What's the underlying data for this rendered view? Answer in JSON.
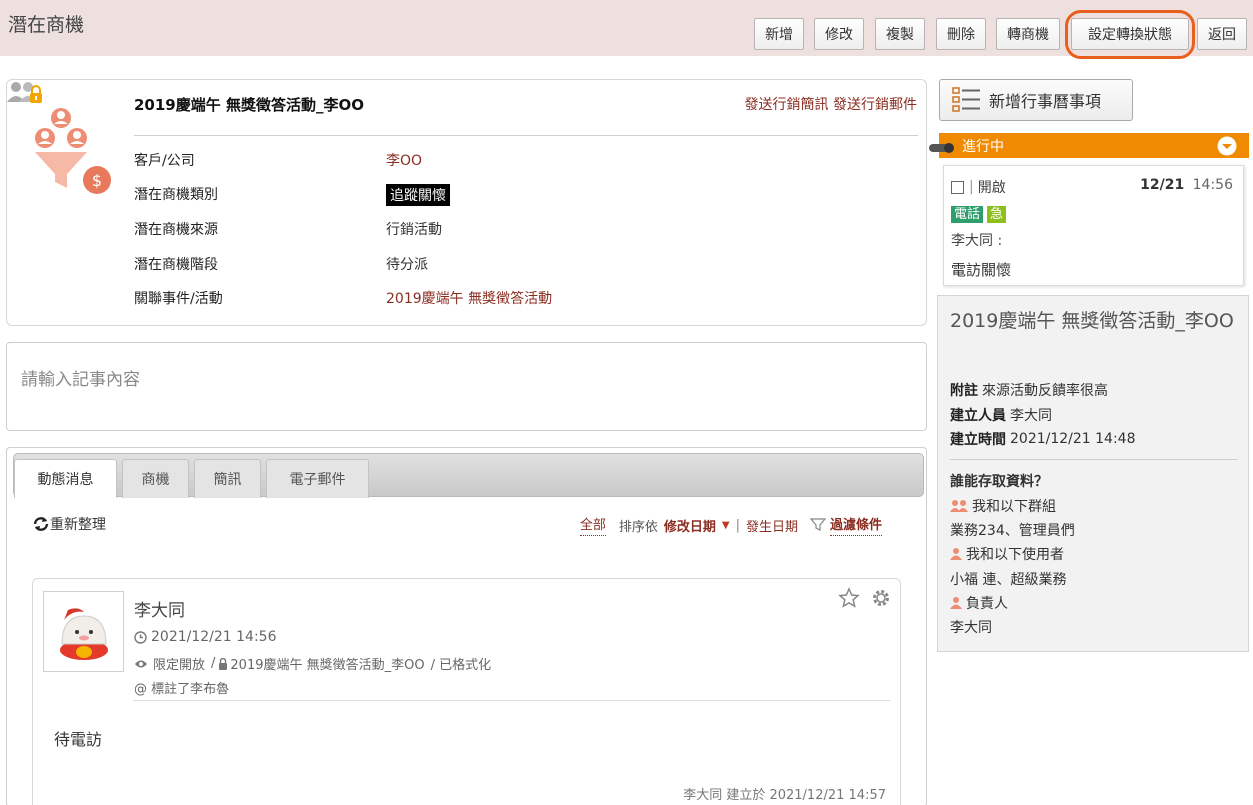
{
  "header": {
    "title": "潛在商機",
    "buttons": {
      "add": "新增",
      "edit": "修改",
      "copy": "複製",
      "delete": "刪除",
      "convert": "轉商機",
      "set_status": "設定轉換狀態",
      "back": "返回"
    }
  },
  "record": {
    "title": "2019慶端午 無獎徵答活動_李OO",
    "links": {
      "send_sms": "發送行銷簡訊",
      "send_mail": "發送行銷郵件"
    },
    "fields": [
      {
        "label": "客戶/公司",
        "value": "李OO"
      },
      {
        "label": "潛在商機類別",
        "value": "追蹤關懷"
      },
      {
        "label": "潛在商機來源",
        "value": "行銷活動"
      },
      {
        "label": "潛在商機階段",
        "value": "待分派"
      },
      {
        "label": "關聯事件/活動",
        "value": "2019慶端午 無獎徵答活動"
      }
    ]
  },
  "notes": {
    "placeholder": "請輸入記事內容"
  },
  "feed": {
    "tabs": [
      "動態消息",
      "商機",
      "簡訊",
      "電子郵件"
    ],
    "refresh": "重新整理",
    "sort": {
      "all": "全部",
      "sort_by": "排序依",
      "modified": "修改日期",
      "sep": "|",
      "occurred": "發生日期",
      "filter": "過濾條件"
    },
    "post": {
      "author": "李大同",
      "time": "2021/12/21 14:56",
      "visibility": "限定開放",
      "link": "2019慶端午 無獎徵答活動_李OO",
      "formatted": "/ 已格式化",
      "mention": "@ 標註了李布魯",
      "body": "待電訪",
      "footer": "李大同 建立於 2021/12/21 14:57"
    }
  },
  "calendar": {
    "add_label": "新增行事曆事項"
  },
  "progress": {
    "label": "進行中",
    "task": {
      "status": "開啟",
      "date": "12/21",
      "time": "14:56",
      "tag_phone": "電話",
      "tag_urgent": "急",
      "person": "李大同 :",
      "desc": "電訪關懷"
    }
  },
  "info": {
    "title": "2019慶端午 無獎徵答活動_李OO",
    "note_label": "附註",
    "note_value": "來源活動反饋率很高",
    "creator_label": "建立人員",
    "creator_value": "李大同",
    "created_label": "建立時間",
    "created_value": "2021/12/21 14:48",
    "access_title": "誰能存取資料？",
    "group_label": "我和以下群組",
    "group_value": "業務234、管理員們",
    "user_label": "我和以下使用者",
    "user_value": "小福 連、超級業務",
    "owner_label": "負責人",
    "owner_value": "李大同"
  },
  "colors": {
    "brand_red": "#8b2e22",
    "orange": "#f08a00",
    "highlight": "#e8601c",
    "header_bg": "#ede0df",
    "tag_green": "#2e9e6c",
    "tag_lime": "#8dbf1f"
  }
}
